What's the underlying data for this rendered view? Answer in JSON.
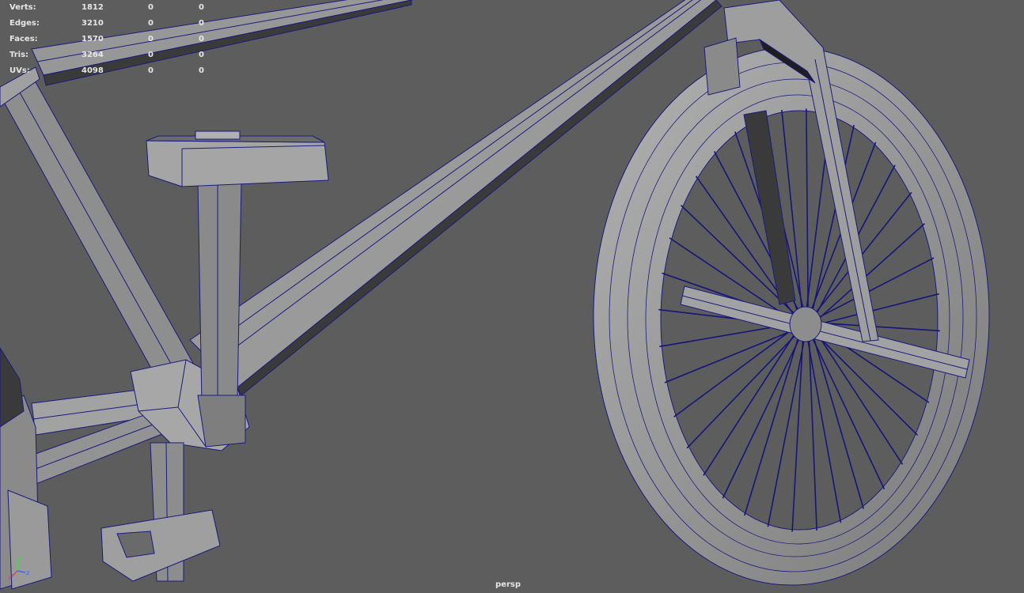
{
  "hud": {
    "rows": [
      {
        "label": "Verts:",
        "total": "1812",
        "selected": "0",
        "selected2": "0"
      },
      {
        "label": "Edges:",
        "total": "3210",
        "selected": "0",
        "selected2": "0"
      },
      {
        "label": "Faces:",
        "total": "1570",
        "selected": "0",
        "selected2": "0"
      },
      {
        "label": "Tris:",
        "total": "3264",
        "selected": "0",
        "selected2": "0"
      },
      {
        "label": "UVs:",
        "total": "4098",
        "selected": "0",
        "selected2": "0"
      }
    ]
  },
  "viewport": {
    "camera": "persp",
    "background_color": "#5d5d5d",
    "mesh_color": "#8c8c8c",
    "wire_color": "#1a1a80"
  },
  "axis_gizmo": {
    "x_label": "x",
    "y_label": "y",
    "z_label": "z",
    "x_color": "#e04040",
    "y_color": "#40e040",
    "z_color": "#4060ff"
  }
}
